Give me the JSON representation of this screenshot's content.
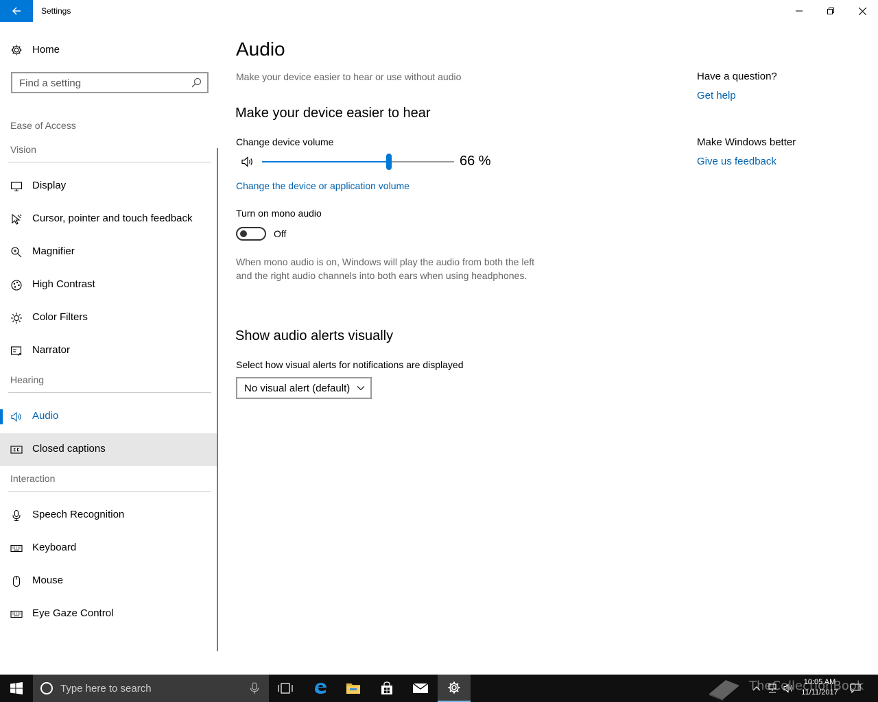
{
  "window": {
    "title": "Settings",
    "minimize_icon": "minimize-icon",
    "maximize_icon": "restore-icon",
    "close_icon": "close-icon"
  },
  "sidebar": {
    "home_label": "Home",
    "search_placeholder": "Find a setting",
    "section_label": "Ease of Access",
    "groups": [
      {
        "heading": "Vision",
        "items": [
          {
            "label": "Display",
            "icon": "monitor-icon"
          },
          {
            "label": "Cursor, pointer and touch feedback",
            "icon": "cursor-icon"
          },
          {
            "label": "Magnifier",
            "icon": "magnifier-icon"
          },
          {
            "label": "High Contrast",
            "icon": "contrast-icon"
          },
          {
            "label": "Color Filters",
            "icon": "sun-icon"
          },
          {
            "label": "Narrator",
            "icon": "narrator-icon"
          }
        ]
      },
      {
        "heading": "Hearing",
        "items": [
          {
            "label": "Audio",
            "icon": "speaker-icon",
            "state": "selected"
          },
          {
            "label": "Closed captions",
            "icon": "cc-icon",
            "state": "hover"
          }
        ]
      },
      {
        "heading": "Interaction",
        "items": [
          {
            "label": "Speech Recognition",
            "icon": "microphone-icon"
          },
          {
            "label": "Keyboard",
            "icon": "keyboard-icon"
          },
          {
            "label": "Mouse",
            "icon": "mouse-icon"
          },
          {
            "label": "Eye Gaze Control",
            "icon": "eye-gaze-icon"
          }
        ]
      }
    ]
  },
  "main": {
    "title": "Audio",
    "subtitle": "Make your device easier to hear or use without audio",
    "hear_heading": "Make your device easier to hear",
    "volume_label": "Change device volume",
    "volume_value": 66,
    "volume_text": "66 %",
    "volume_link": "Change the device or application volume",
    "mono_label": "Turn on mono audio",
    "mono_state": "Off",
    "mono_desc": "When mono audio is on, Windows will play the audio from both the left and the right audio channels into both ears when using headphones.",
    "alerts_heading": "Show audio alerts visually",
    "alerts_label": "Select how visual alerts for notifications are displayed",
    "alerts_value": "No visual alert (default)"
  },
  "aside": {
    "question": "Have a question?",
    "help_link": "Get help",
    "better": "Make Windows better",
    "feedback_link": "Give us feedback"
  },
  "taskbar": {
    "search_placeholder": "Type here to search",
    "apps": [
      "task-view-icon",
      "edge-icon",
      "file-explorer-icon",
      "store-icon",
      "mail-icon",
      "settings-icon"
    ],
    "active_app": "settings-icon",
    "time": "10:05 AM",
    "date": "11/11/2017",
    "watermark": "TheCollectionBook"
  },
  "colors": {
    "accent": "#0078d7",
    "link": "#0063b1",
    "taskbar": "#101010"
  }
}
